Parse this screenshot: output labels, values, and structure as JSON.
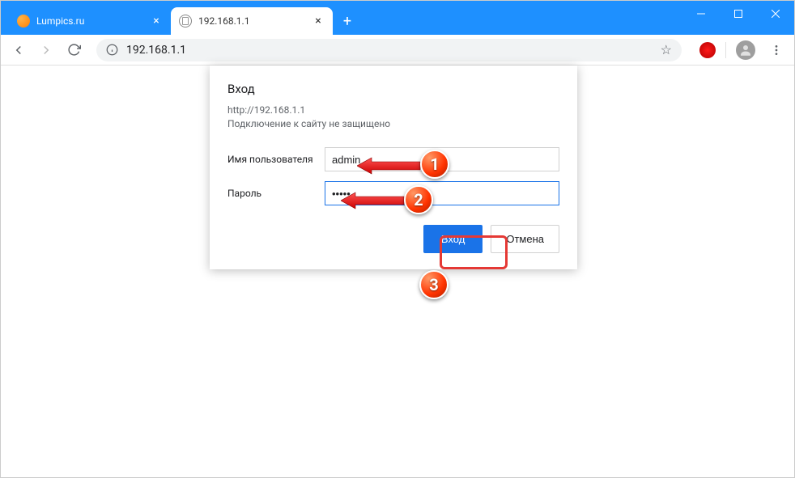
{
  "tabs": [
    {
      "title": "Lumpics.ru",
      "active": false
    },
    {
      "title": "192.168.1.1",
      "active": true
    }
  ],
  "address_bar": {
    "url": "192.168.1.1"
  },
  "dialog": {
    "title": "Вход",
    "url": "http://192.168.1.1",
    "warning": "Подключение к сайту не защищено",
    "username_label": "Имя пользователя",
    "username_value": "admin",
    "password_label": "Пароль",
    "password_value": "•••••",
    "submit_label": "Вход",
    "cancel_label": "Отмена"
  },
  "callouts": {
    "badge1": "1",
    "badge2": "2",
    "badge3": "3"
  }
}
